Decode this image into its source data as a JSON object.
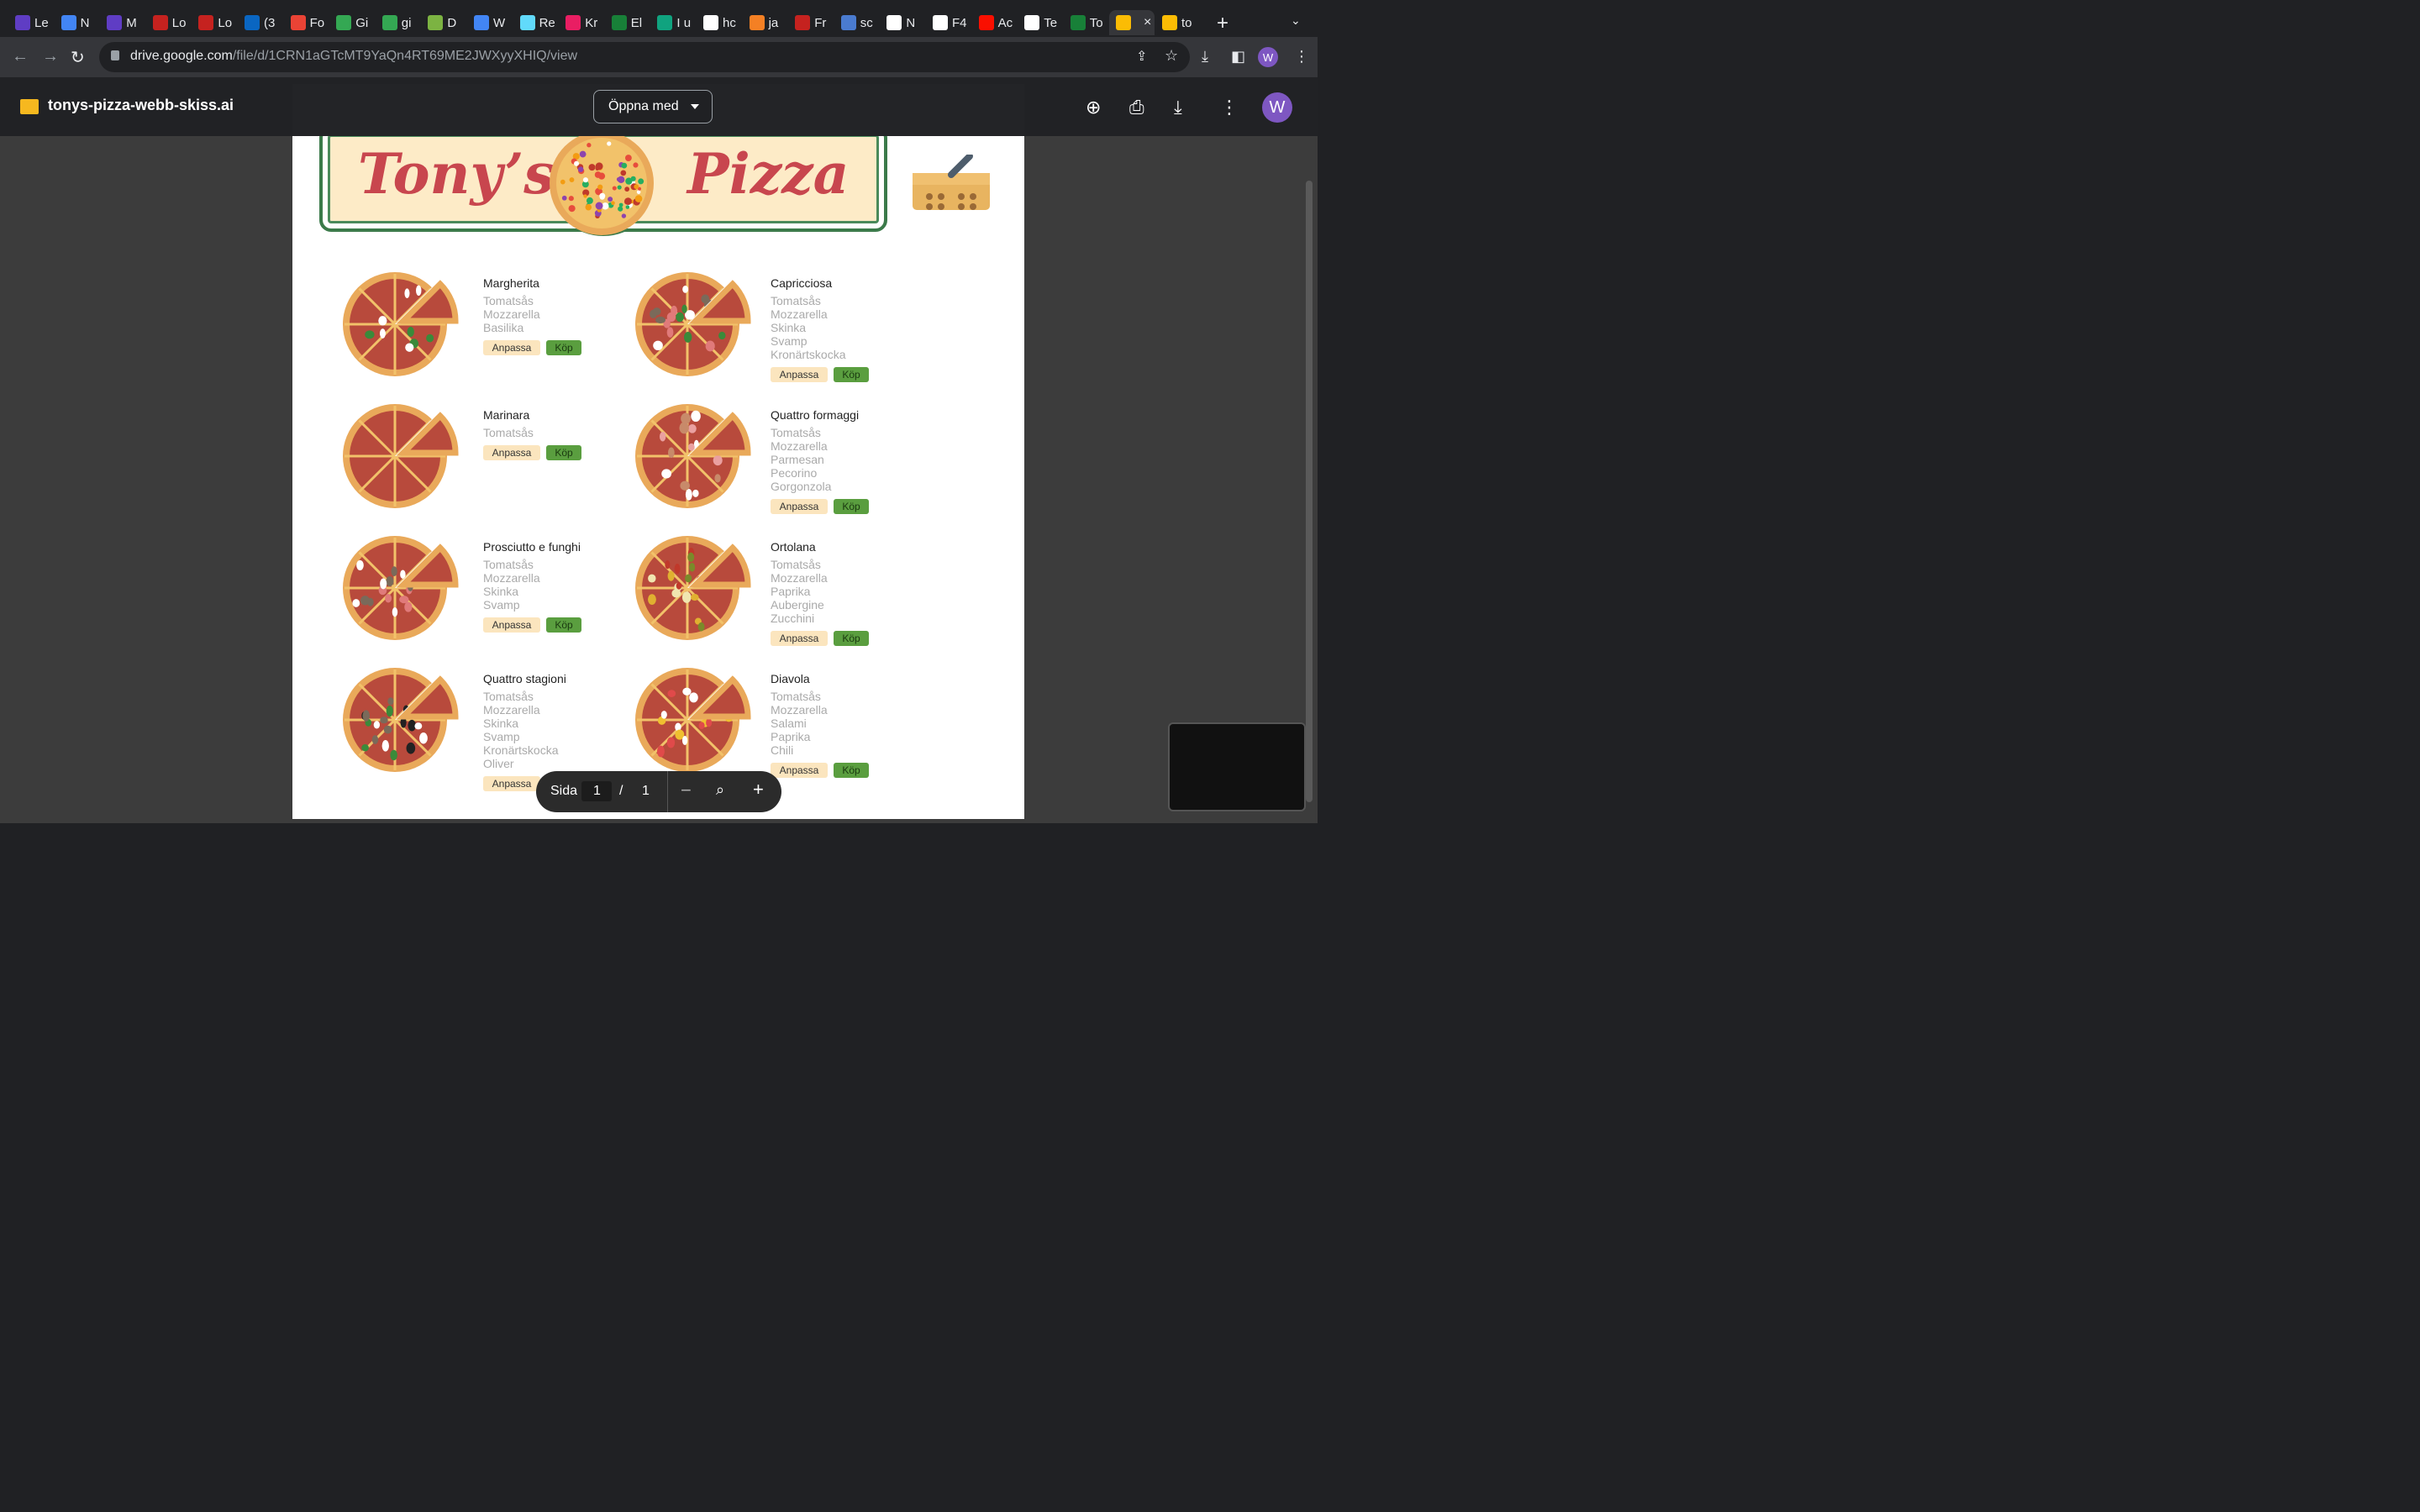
{
  "browser": {
    "tabs": [
      "Le",
      "N",
      "M",
      "Lo",
      "Lo",
      "(3",
      "Fo",
      "Gi",
      "gi",
      "D",
      "W",
      "Re",
      "Kr",
      "El",
      "I u",
      "hc",
      "ja",
      "Fr",
      "sc",
      "N",
      "F4",
      "Ac",
      "Te",
      "To",
      "",
      ""
    ],
    "active_tab_close": "×",
    "url_host": "drive.google.com",
    "url_path": "/file/d/1CRN1aGTcMT9YaQn4RT69ME2JWXyyXHIQ/view",
    "last_tab": "to",
    "profile_initial": "W",
    "colors": {
      "tab_strip": "#202124",
      "toolbar": "#35363a",
      "avatar": "#7e57c2"
    }
  },
  "drive": {
    "file_title": "tonys-pizza-webb-skiss.ai",
    "open_with": "Öppna med",
    "avatar_initial": "W"
  },
  "menu": {
    "brand_left": "Tony’s",
    "brand_right": "Pizza",
    "anpassa": "Anpassa",
    "kop": "Köp",
    "pizzas": [
      {
        "name": "Margherita",
        "ingredients": [
          "Tomatsås",
          "Mozzarella",
          "Basilika"
        ]
      },
      {
        "name": "Capricciosa",
        "ingredients": [
          "Tomatsås",
          "Mozzarella",
          "Skinka",
          "Svamp",
          "Kronärtskocka"
        ]
      },
      {
        "name": "Marinara",
        "ingredients": [
          "Tomatsås"
        ]
      },
      {
        "name": "Quattro formaggi",
        "ingredients": [
          "Tomatsås",
          "Mozzarella",
          "Parmesan",
          "Pecorino",
          "Gorgonzola"
        ]
      },
      {
        "name": "Prosciutto e funghi",
        "ingredients": [
          "Tomatsås",
          "Mozzarella",
          "Skinka",
          "Svamp"
        ]
      },
      {
        "name": "Ortolana",
        "ingredients": [
          "Tomatsås",
          "Mozzarella",
          "Paprika",
          "Aubergine",
          "Zucchini"
        ]
      },
      {
        "name": "Quattro stagioni",
        "ingredients": [
          "Tomatsås",
          "Mozzarella",
          "Skinka",
          "Svamp",
          "Kronärtskocka",
          "Oliver"
        ]
      },
      {
        "name": "Diavola",
        "ingredients": [
          "Tomatsås",
          "Mozzarella",
          "Salami",
          "Paprika",
          "Chili"
        ]
      }
    ],
    "colors": {
      "brand": "#c8464e",
      "banner": "#fdebc7",
      "frame": "#3b7a4a",
      "kop": "#5a9e3f",
      "anpassa": "#fbe5be"
    }
  },
  "pager": {
    "label": "Sida",
    "current": "1",
    "sep": "/",
    "total": "1"
  }
}
